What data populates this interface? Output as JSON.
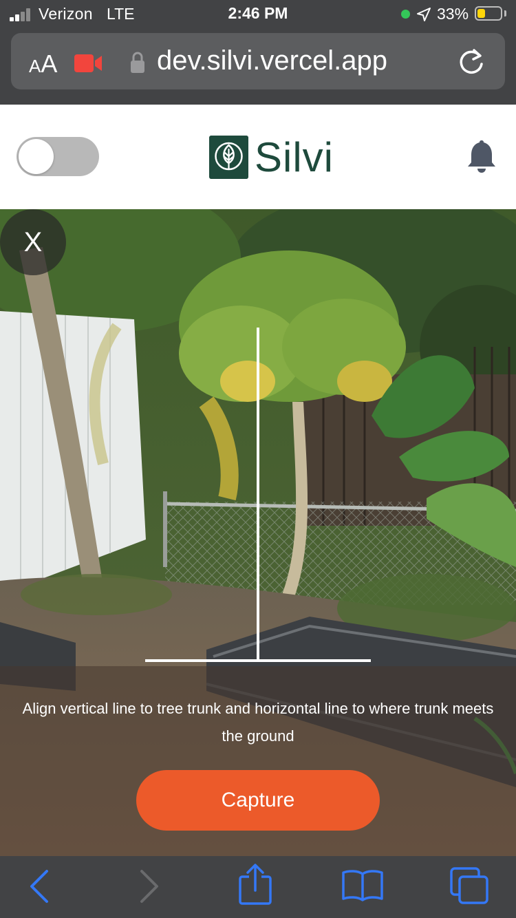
{
  "status_bar": {
    "carrier": "Verizon",
    "network": "LTE",
    "time": "2:46 PM",
    "battery_percent": "33%",
    "battery_level": 0.33,
    "signal_bars": 2,
    "recording_dot_color": "#34c759",
    "battery_color": "#ffd60a"
  },
  "browser": {
    "text_size_label_small": "A",
    "text_size_label_large": "A",
    "url": "dev.silvi.vercel.app",
    "camera_icon": "video-camera-icon",
    "camera_icon_color": "#f2453d",
    "lock_icon": "lock-icon",
    "reload_icon": "reload-icon"
  },
  "app_header": {
    "brand_name": "Silvi",
    "brand_color": "#1e4a3c",
    "toggle_state": "off",
    "notification_icon": "bell-icon"
  },
  "camera": {
    "close_label": "X",
    "instruction": "Align vertical line to tree trunk and horizontal line to where trunk meets the ground",
    "capture_label": "Capture",
    "capture_color": "#ec5a2a"
  },
  "toolbar": {
    "back_icon": "back-arrow-icon",
    "forward_icon": "forward-arrow-icon",
    "share_icon": "share-icon",
    "bookmarks_icon": "bookmarks-icon",
    "tabs_icon": "tabs-icon",
    "accent_color": "#3478f6"
  }
}
